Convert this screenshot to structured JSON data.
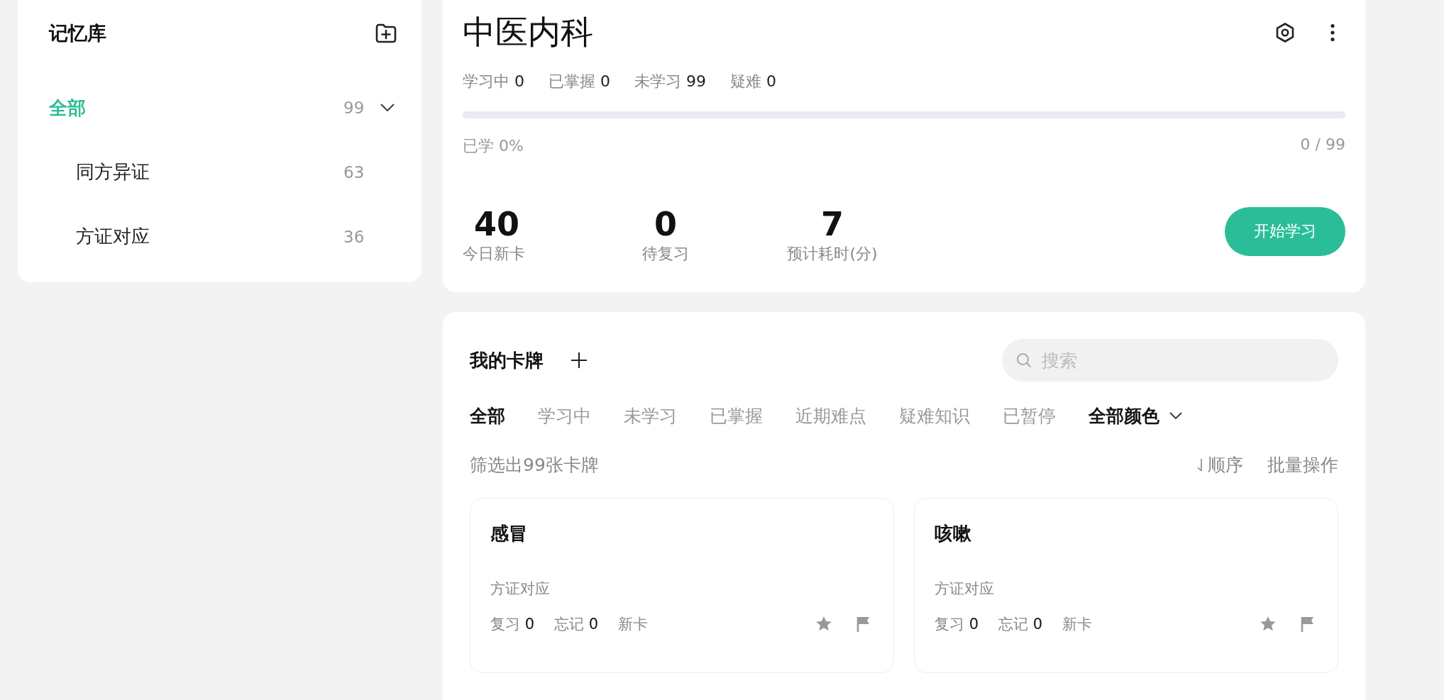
{
  "sidebar": {
    "title": "记忆库",
    "items": [
      {
        "label": "全部",
        "count": "99",
        "selected": true,
        "expanded": true,
        "children": [
          {
            "label": "同方异证",
            "count": "63",
            "selected": false
          },
          {
            "label": "方证对应",
            "count": "36",
            "selected": false
          }
        ]
      }
    ]
  },
  "deck": {
    "title": "中医内科",
    "stats": [
      {
        "label": "学习中",
        "value": "0"
      },
      {
        "label": "已掌握",
        "value": "0"
      },
      {
        "label": "未学习",
        "value": "99"
      },
      {
        "label": "疑难",
        "value": "0"
      }
    ],
    "progress": {
      "level": 0,
      "label": "已学 0%",
      "count": "0 / 99"
    },
    "summary": [
      {
        "value": "40",
        "label": "今日新卡"
      },
      {
        "value": "0",
        "label": "待复习"
      },
      {
        "value": "7",
        "label": "预计耗时(分)"
      }
    ],
    "start_button": "开始学习"
  },
  "cards_panel": {
    "title": "我的卡牌",
    "search": {
      "placeholder": "搜索"
    },
    "filters": [
      {
        "label": "全部",
        "selected": true
      },
      {
        "label": "学习中",
        "selected": false
      },
      {
        "label": "未学习",
        "selected": false
      },
      {
        "label": "已掌握",
        "selected": false
      },
      {
        "label": "近期难点",
        "selected": false
      },
      {
        "label": "疑难知识",
        "selected": false
      },
      {
        "label": "已暂停",
        "selected": false
      }
    ],
    "color_filter": "全部颜色",
    "result": "筛选出99张卡牌",
    "sort": "顺序",
    "batch": "批量操作",
    "cards": [
      {
        "title": "感冒",
        "category": "方证对应",
        "review_label": "复习",
        "review": "0",
        "forget_label": "忘记",
        "forget": "0",
        "status": "新卡"
      },
      {
        "title": "咳嗽",
        "category": "方证对应",
        "review_label": "复习",
        "review": "0",
        "forget_label": "忘记",
        "forget": "0",
        "status": "新卡"
      }
    ]
  }
}
